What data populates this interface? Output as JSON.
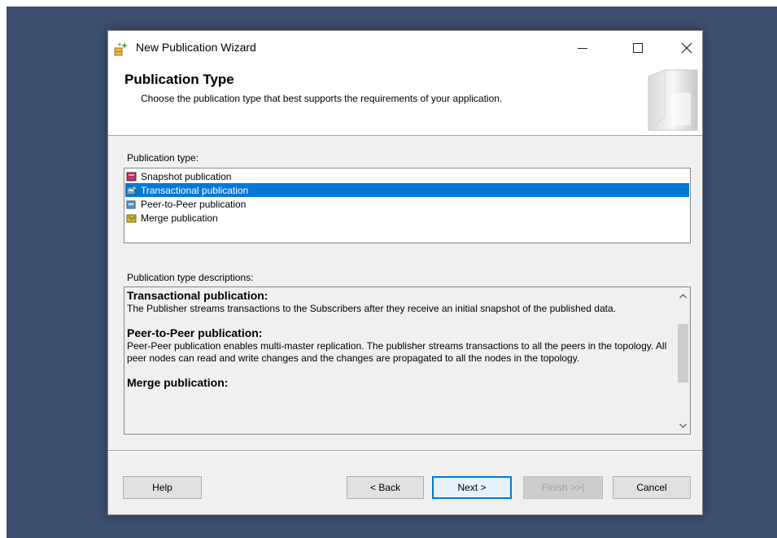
{
  "window": {
    "title": "New Publication Wizard",
    "controls": {
      "minimize": "minimize-icon",
      "maximize": "maximize-icon",
      "close": "close-icon"
    }
  },
  "header": {
    "title": "Publication Type",
    "subtitle": "Choose the publication type that best supports the requirements of your application."
  },
  "publication_type": {
    "label": "Publication type:",
    "items": [
      {
        "label": "Snapshot publication",
        "icon": "snapshot-publication-icon",
        "selected": false
      },
      {
        "label": "Transactional publication",
        "icon": "transactional-publication-icon",
        "selected": true
      },
      {
        "label": "Peer-to-Peer publication",
        "icon": "peer-to-peer-publication-icon",
        "selected": false
      },
      {
        "label": "Merge publication",
        "icon": "merge-publication-icon",
        "selected": false
      }
    ]
  },
  "descriptions": {
    "label": "Publication type descriptions:",
    "items": [
      {
        "heading": "Transactional publication:",
        "body": "The Publisher streams transactions to the Subscribers after they receive an initial snapshot of the published data."
      },
      {
        "heading": "Peer-to-Peer publication:",
        "body": "Peer-Peer publication enables multi-master replication. The publisher streams transactions to all the peers in the topology. All peer nodes can read and write changes and the changes are propagated to all the nodes in the topology."
      },
      {
        "heading": "Merge publication:",
        "body": ""
      }
    ]
  },
  "buttons": {
    "help": "Help",
    "back": "< Back",
    "next": "Next >",
    "finish": "Finish >>|",
    "cancel": "Cancel"
  },
  "colors": {
    "selection": "#0078d7",
    "default_button_border": "#0078d7",
    "dialog_background": "#f0f0f0",
    "desktop": "#3d4f6e"
  }
}
